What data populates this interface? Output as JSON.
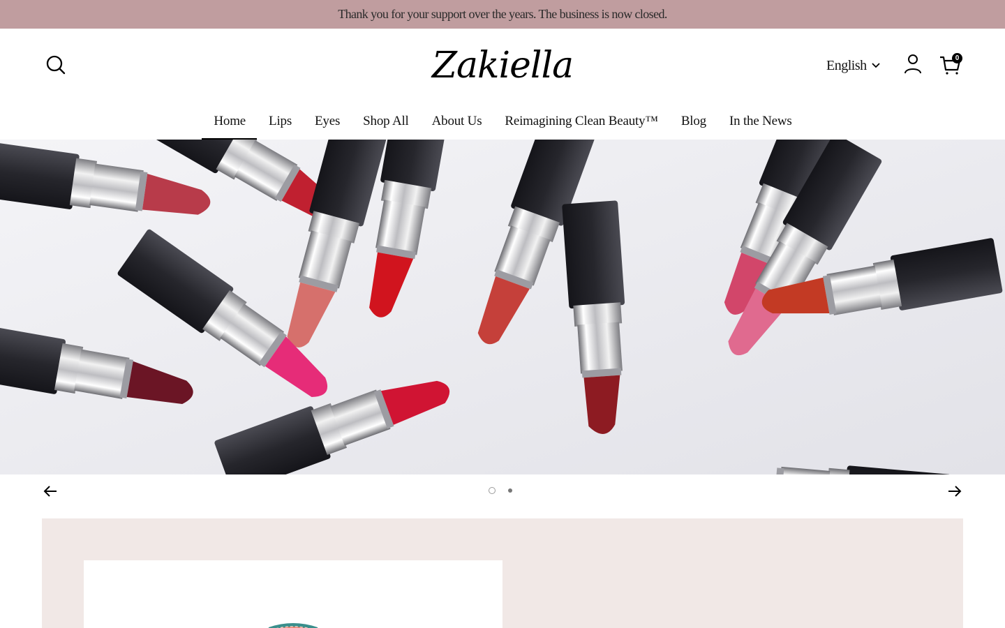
{
  "announcement": "Thank you for your support over the years. The business is now closed.",
  "header": {
    "logo": "Zakiella",
    "language": "English",
    "cart_count": "0"
  },
  "nav": {
    "items": [
      {
        "label": "Home"
      },
      {
        "label": "Lips"
      },
      {
        "label": "Eyes"
      },
      {
        "label": "Shop All"
      },
      {
        "label": "About Us"
      },
      {
        "label": "Reimagining Clean Beauty™"
      },
      {
        "label": "Blog"
      },
      {
        "label": "In the News"
      }
    ],
    "active": "Home"
  },
  "icons": {
    "search": "search-icon",
    "language_chevron": "chevron-down-icon",
    "account": "user-icon",
    "cart": "shopping-bag-icon",
    "prev": "arrow-left-icon",
    "next": "arrow-right-icon"
  },
  "slideshow": {
    "current_slide": 1,
    "total_slides": 2
  },
  "colors": {
    "announcement_bg": "#c09d9f",
    "feature_bg": "#f1e8e6",
    "accent": "#000000"
  }
}
